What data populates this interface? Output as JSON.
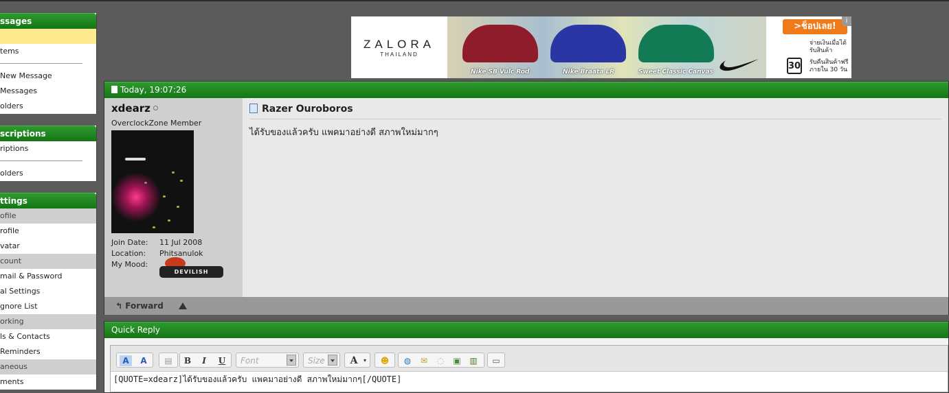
{
  "sidebar": {
    "messages": {
      "title": "ssages",
      "items": [
        "",
        "tems",
        "New Message",
        "Messages",
        "olders"
      ]
    },
    "subscriptions": {
      "title": "scriptions",
      "items": [
        "riptions",
        "olders"
      ]
    },
    "settings": {
      "title": "ttings",
      "items": [
        "ofile",
        "rofile",
        "vatar",
        "count",
        "mail & Password",
        "al Settings",
        "gnore List",
        "orking",
        "ls & Contacts",
        " Reminders",
        "aneous",
        "ments"
      ]
    }
  },
  "ad": {
    "brand": "ZALORA",
    "brand_sub": "THAILAND",
    "shoes": [
      "Nike SB Vulc Rod",
      "Nike Braata LR",
      "Sweet Classic Canvas"
    ],
    "shop_button": ">ช็อปเลย!",
    "cod_text": "จ่ายเงินเมื่อได้ รับสินค้า",
    "return_text": "รับคืนสินค้าฟรี ภายใน 30 วัน",
    "return_days": "30",
    "info": "i"
  },
  "post": {
    "timestamp": "Today, 19:07:26",
    "username": "xdearz",
    "user_title": "OverclockZone Member",
    "join_date_label": "Join Date:",
    "join_date": "11 Jul 2008",
    "location_label": "Location:",
    "location": "Phitsanulok",
    "mood_label": "My Mood:",
    "mood": "DEVILISH",
    "title": "Razer Ouroboros",
    "body": "ได้รับของแล้วครับ แพคมาอย่างดี สภาพใหม่มากๆ",
    "forward_label": "Forward"
  },
  "quick_reply": {
    "title": "Quick Reply",
    "font_placeholder": "Font",
    "size_placeholder": "Size",
    "content": "[QUOTE=xdearz]ได้รับของแล้วครับ แพคมาอย่างดี  สภาพใหม่มากๆ[/QUOTE]"
  },
  "colors": {
    "header_green": "#147514",
    "background": "#5b5b5b",
    "highlight": "#fde98e"
  }
}
